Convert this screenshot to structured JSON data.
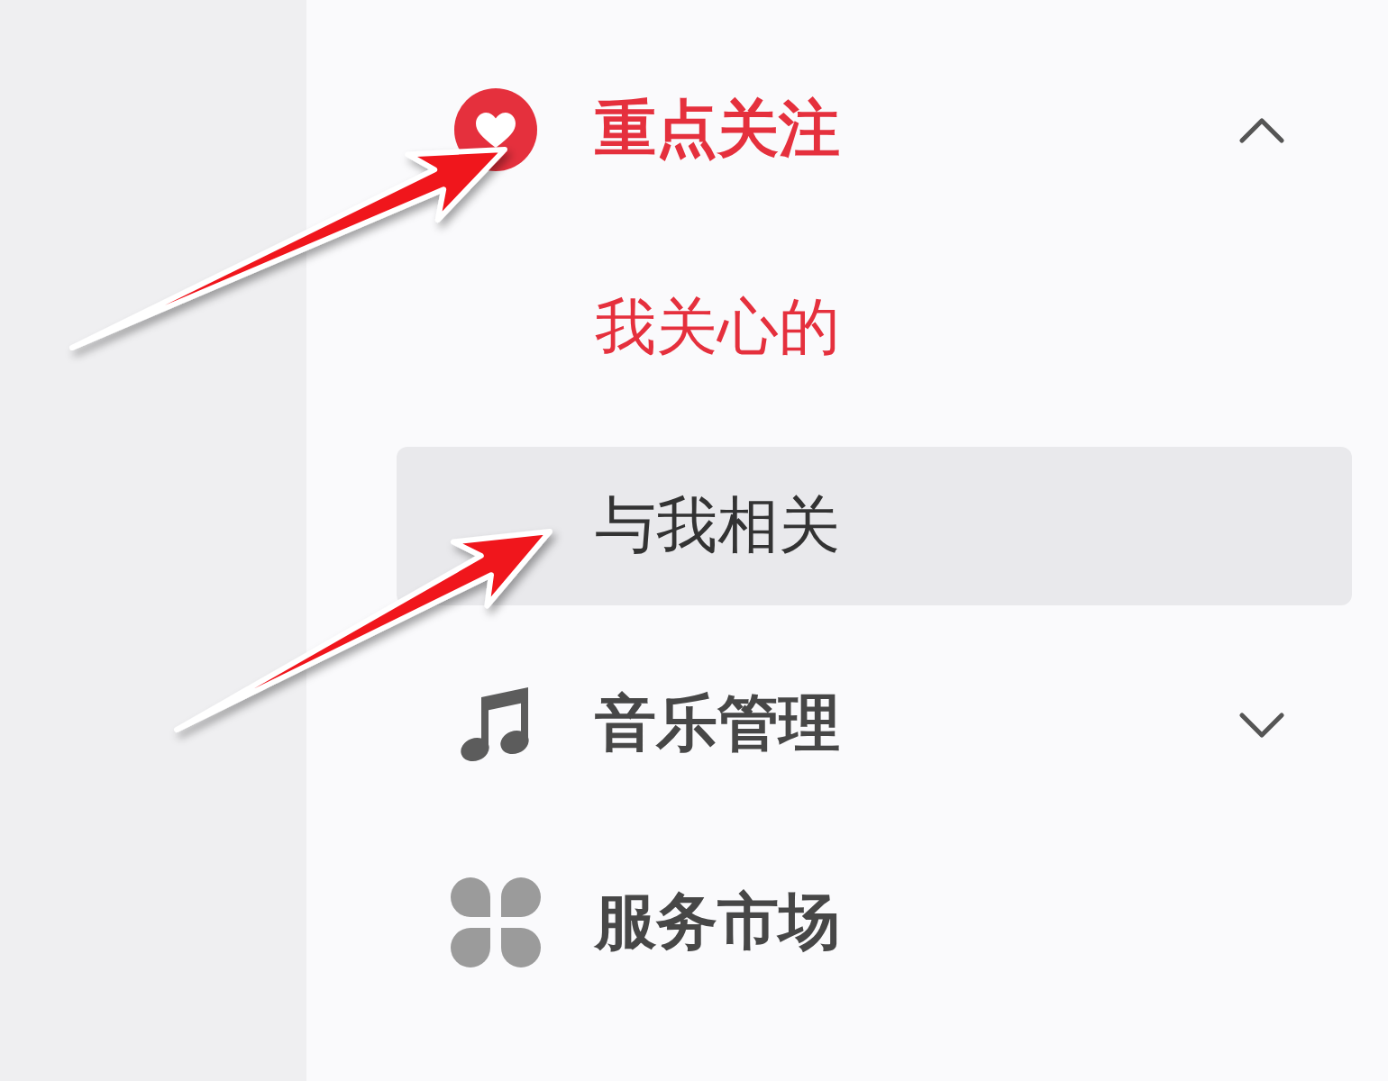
{
  "sidebar": {
    "items": [
      {
        "label": "重点关注",
        "active": true,
        "expanded": true,
        "pointer_arrow": true,
        "children": [
          {
            "label": "我关心的",
            "selected": true,
            "hovered": false,
            "pointer_arrow": false
          },
          {
            "label": "与我相关",
            "selected": false,
            "hovered": true,
            "pointer_arrow": true
          }
        ]
      },
      {
        "label": "音乐管理",
        "active": false,
        "expanded": false,
        "pointer_arrow": false
      },
      {
        "label": "服务市场",
        "active": false,
        "pointer_arrow": false
      }
    ]
  }
}
